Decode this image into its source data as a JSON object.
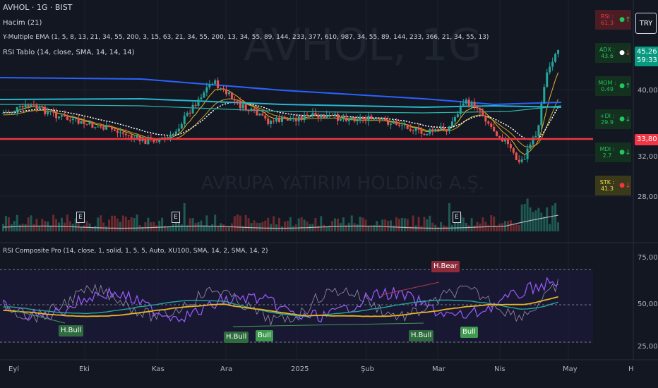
{
  "header": {
    "symbol_line": "AVHOL · 1G · BIST",
    "indicators": [
      "Hacim (21)",
      "Y-Multiple EMA (1, 5, 8, 13, 21, 34, 55, 200, 3, 15, 63, 21, 34, 55, 200, 13, 34, 55, 89, 144, 233, 377, 610, 987, 34, 55, 89, 144, 233, 366, 21, 34, 55, 13)",
      "RSI Tablo (14, close, SMA, 14, 14, 14)"
    ],
    "currency_button": "TRY"
  },
  "watermark": {
    "symbol": "AVHOL, 1G",
    "company": "AVRUPA YATIRIM HOLDİNG A.Ş."
  },
  "price_axis": {
    "ticks": [
      "40,00",
      "32,00",
      "28,00"
    ],
    "last_price": "45,26",
    "countdown": "59:33",
    "line_price": "33,80"
  },
  "rsi_panel": {
    "title": "RSI Composite Pro (14, close, 1, solid, 1, 5, 5, Auto, XU100, SMA, 14, 2, SMA, 14, 2)",
    "ticks": [
      "75,00",
      "50,00",
      "25,00"
    ],
    "labels": {
      "bear": "H.Bear",
      "hbull1": "H.Bull",
      "hbull2": "H.Bull",
      "bull1": "Bull",
      "hbull3": "H.Bull",
      "bull2": "Bull"
    }
  },
  "volume_events": [
    "E",
    "E",
    "E"
  ],
  "time_axis": [
    "Eyl",
    "Eki",
    "Kas",
    "Ara",
    "2025",
    "Şub",
    "Mar",
    "Nis",
    "May",
    "H"
  ],
  "rsi_table": [
    {
      "label": "RSI : 61.3",
      "dot": "●",
      "arrow": "↑",
      "bg": "#4a1d24",
      "fg": "#f23645",
      "dotc": "#22c55e",
      "arrc": "#22c55e"
    },
    {
      "label": "ADX : 43.6",
      "dot": "●",
      "arrow": "↓",
      "bg": "#14301f",
      "fg": "#22c55e",
      "dotc": "#ffffff",
      "arrc": "#f23645"
    },
    {
      "label": "MOM : 0.49",
      "dot": "●",
      "arrow": "↑",
      "bg": "#14301f",
      "fg": "#22c55e",
      "dotc": "#22c55e",
      "arrc": "#22c55e"
    },
    {
      "label": "+DI : 29.9",
      "dot": "●",
      "arrow": "↓",
      "bg": "#14301f",
      "fg": "#22c55e",
      "dotc": "#22c55e",
      "arrc": "#22c55e"
    },
    {
      "label": "MDI : 2.7",
      "dot": "●",
      "arrow": "↓",
      "bg": "#14301f",
      "fg": "#22c55e",
      "dotc": "#22c55e",
      "arrc": "#22c55e"
    },
    {
      "label": "STK : 41.3",
      "dot": "●",
      "arrow": "↓",
      "bg": "#3a3a1a",
      "fg": "#f5e050",
      "dotc": "#f23645",
      "arrc": "#f23645"
    }
  ],
  "colors": {
    "bg": "#131722",
    "up": "#26a69a",
    "down": "#ef5350",
    "red_line": "#f23645",
    "blue_ema": "#2962ff",
    "cyan_ema": "#22b8cf",
    "rsi_purple": "#9c5cff",
    "rsi_yellow": "#e6b422",
    "rsi_teal": "#26a69a"
  }
}
